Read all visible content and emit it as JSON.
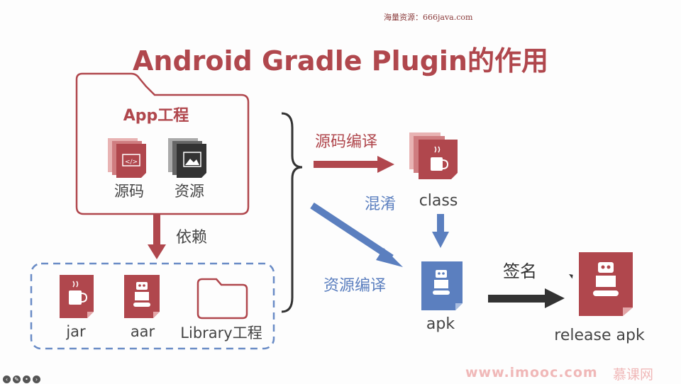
{
  "watermark": "海量资源：666java.com",
  "title": "Android Gradle Plugin的作用",
  "app_project": {
    "title": "App工程",
    "source": "源码",
    "resource": "资源"
  },
  "dependency_label": "依赖",
  "libraries": {
    "jar": "jar",
    "aar": "aar",
    "library": "Library工程"
  },
  "steps": {
    "compile_source": "源码编译",
    "obfuscate": "混淆",
    "compile_resource": "资源编译",
    "sign": "签名"
  },
  "outputs": {
    "class": "class",
    "apk": "apk",
    "release_apk": "release apk"
  },
  "footer": {
    "site": "www.imooc.com",
    "brand": "慕课网"
  },
  "colors": {
    "red": "#b0474d",
    "blue": "#5b7fbf",
    "dark": "#333333",
    "dashed_border": "#6a8cc6"
  }
}
